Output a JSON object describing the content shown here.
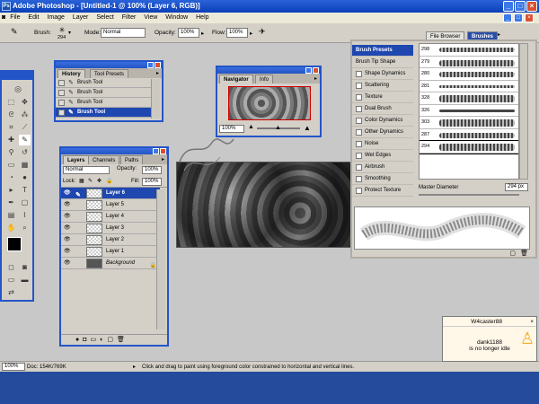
{
  "app": {
    "title": "Adobe Photoshop - [Untitled-1 @ 100% (Layer 6, RGB)]",
    "icon": "ps-app-icon"
  },
  "menu": [
    "File",
    "Edit",
    "Image",
    "Layer",
    "Select",
    "Filter",
    "View",
    "Window",
    "Help"
  ],
  "options": {
    "brush_label": "Brush:",
    "brush_size": "294",
    "mode_label": "Mode:",
    "mode_value": "Normal",
    "opacity_label": "Opacity:",
    "opacity_value": "100%",
    "flow_label": "Flow:",
    "flow_value": "100%"
  },
  "well": {
    "tabs": [
      "File Browser",
      "Brushes"
    ]
  },
  "history": {
    "tabs": [
      "History",
      "Tool Presets"
    ],
    "items": [
      "Brush Tool",
      "Brush Tool",
      "Brush Tool",
      "Brush Tool"
    ],
    "selected_index": 3
  },
  "navigator": {
    "tabs": [
      "Navigator",
      "Info"
    ],
    "zoom": "100%"
  },
  "layers": {
    "tabs": [
      "Layers",
      "Channels",
      "Paths"
    ],
    "blend": "Normal",
    "opacity_label": "Opacity:",
    "opacity_value": "100%",
    "lock_label": "Lock:",
    "fill_label": "Fill:",
    "fill_value": "100%",
    "items": [
      "Layer 6",
      "Layer 5",
      "Layer 4",
      "Layer 3",
      "Layer 2",
      "Layer 1",
      "Background"
    ],
    "selected_index": 0
  },
  "brushes": {
    "left_items": [
      {
        "label": "Brush Presets",
        "type": "head"
      },
      {
        "label": "Brush Tip Shape",
        "type": "plain"
      },
      {
        "label": "Shape Dynamics",
        "type": "check"
      },
      {
        "label": "Scattering",
        "type": "check"
      },
      {
        "label": "Texture",
        "type": "check"
      },
      {
        "label": "Dual Brush",
        "type": "check"
      },
      {
        "label": "Color Dynamics",
        "type": "check"
      },
      {
        "label": "Other Dynamics",
        "type": "check"
      },
      {
        "label": "Noise",
        "type": "check"
      },
      {
        "label": "Wet Edges",
        "type": "check"
      },
      {
        "label": "Airbrush",
        "type": "check"
      },
      {
        "label": "Smoothing",
        "type": "check"
      },
      {
        "label": "Protect Texture",
        "type": "check"
      }
    ],
    "tips": [
      "298",
      "279",
      "280",
      "281",
      "328",
      "326",
      "303",
      "287",
      "294"
    ],
    "selected_tip_index": 8,
    "master_diameter_label": "Master Diameter",
    "master_diameter_value": "294 px"
  },
  "status": {
    "zoom": "100%",
    "doc": "Doc: 154K/769K",
    "hint": "Click and drag to paint using foreground color constrained to horizontal and vertical lines."
  },
  "im_popup": {
    "user": "W4caster88",
    "message_line1": "dank1188",
    "message_line2": "is no longer idle"
  },
  "colors": {
    "xp_blue": "#2455c8",
    "selection": "#1f47b0",
    "panel_bg": "#d4d0c8",
    "workspace": "#c8c8c8"
  }
}
